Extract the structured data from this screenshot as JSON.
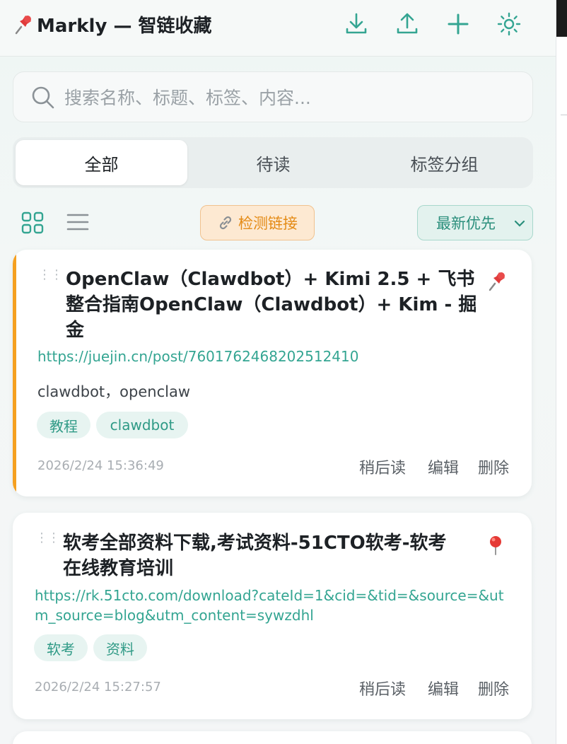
{
  "app": {
    "title": "Markly — 智链收藏"
  },
  "header": {
    "icons": [
      "download-icon",
      "upload-icon",
      "plus-icon",
      "settings-icon"
    ]
  },
  "search": {
    "placeholder": "搜索名称、标题、标签、内容..."
  },
  "tabs": [
    {
      "label": "全部",
      "active": true
    },
    {
      "label": "待读",
      "active": false
    },
    {
      "label": "标签分组",
      "active": false
    }
  ],
  "toolbar": {
    "detect_label": "检测链接",
    "sort_label": "最新优先"
  },
  "colors": {
    "accent": "#34a592",
    "pinned_bar": "#f5a020",
    "detect_text": "#e48a14"
  },
  "bookmarks": [
    {
      "title_line1": "OpenClaw（Clawdbot）+ Kimi 2.5 + 飞书",
      "title_line2": "整合指南OpenClaw（Clawdbot）+ Kim - 掘",
      "title_line3": "金",
      "url": "https://juejin.cn/post/7601762468202512410",
      "description": "clawdbot，openclaw",
      "tags": [
        "教程",
        "clawdbot"
      ],
      "time": "2026/2/24 15:36:49",
      "pinned": true,
      "actions": {
        "later": "稍后读",
        "edit": "编辑",
        "delete": "删除"
      }
    },
    {
      "title_line1": "软考全部资料下载,考试资料-51CTO软考-软考",
      "title_line2": "在线教育培训",
      "url_line1": "https://rk.51cto.com/download?cateId=1&cid=&tid=&source=&ut",
      "url_line2": "m_source=blog&utm_content=sywzdhl",
      "tags": [
        "软考",
        "资料"
      ],
      "time": "2026/2/24 15:27:57",
      "pinned": false,
      "actions": {
        "later": "稍后读",
        "edit": "编辑",
        "delete": "删除"
      }
    }
  ]
}
